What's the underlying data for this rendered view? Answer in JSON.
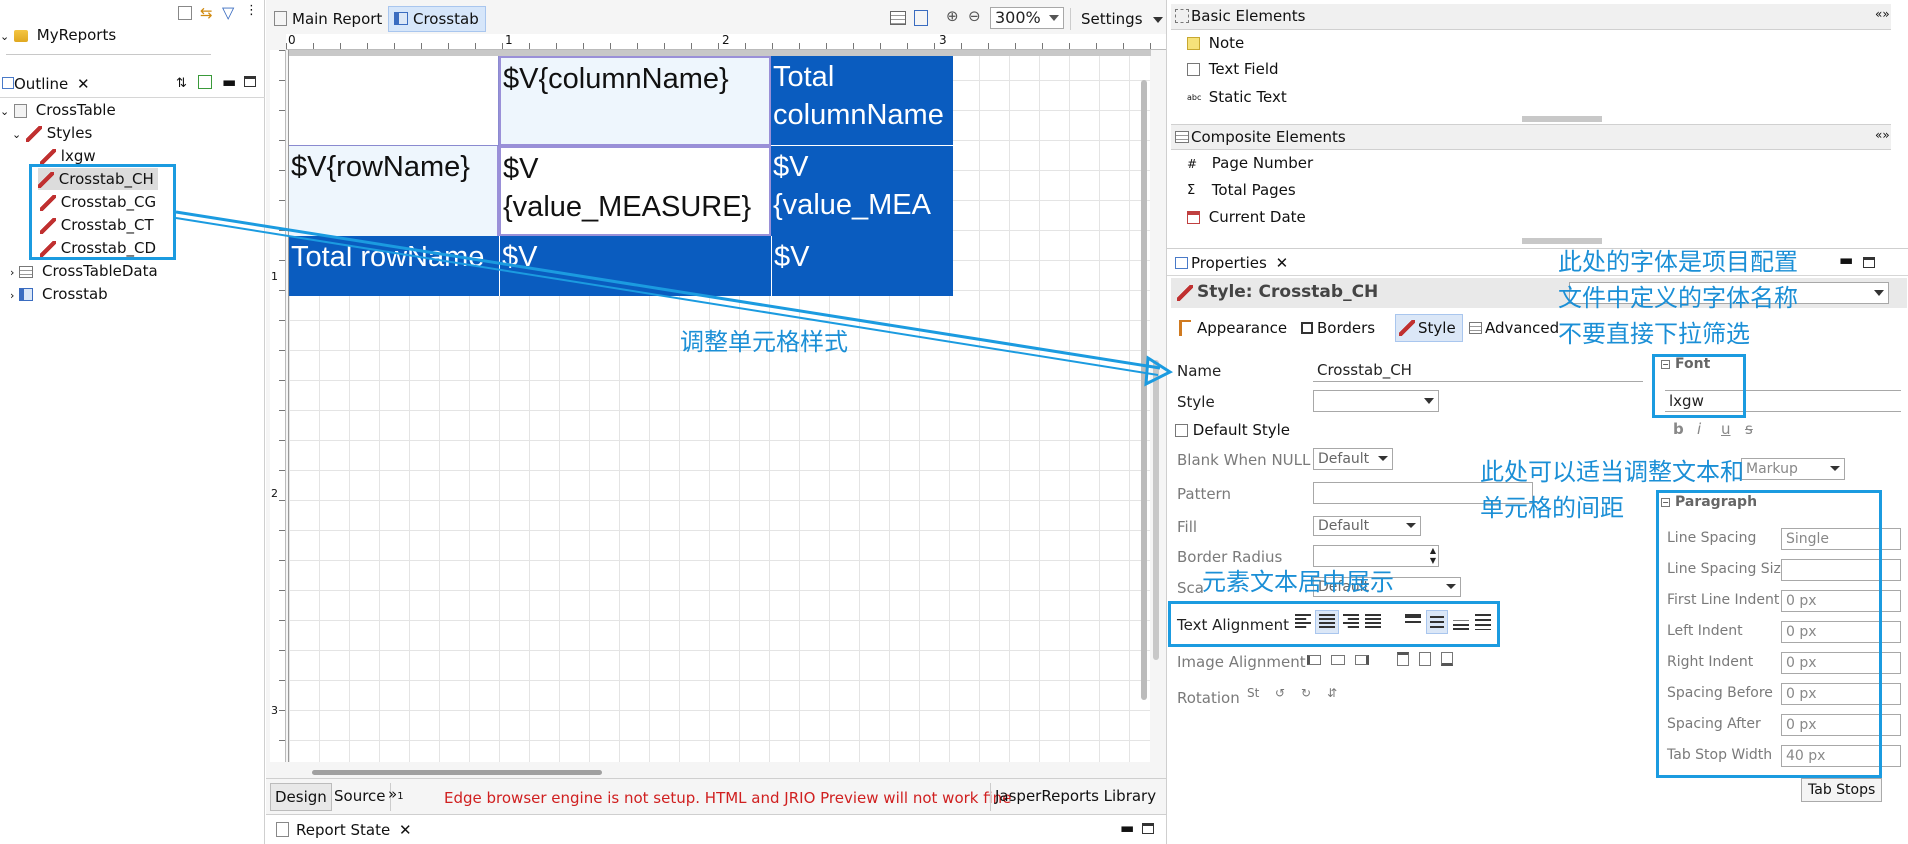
{
  "left": {
    "project_item": "MyReports",
    "outline_tab": "Outline",
    "tree": {
      "root": "CrossTable",
      "styles": "Styles",
      "style_items": [
        "lxgw",
        "Crosstab_CH",
        "Crosstab_CG",
        "Crosstab_CT",
        "Crosstab_CD"
      ],
      "data": "CrossTableData",
      "crosstab": "Crosstab"
    }
  },
  "editor": {
    "tabs": [
      "Main Report",
      "Crosstab"
    ],
    "zoom": "300%",
    "settings": "Settings",
    "ruler_marks": [
      "0",
      "1",
      "2",
      "3"
    ],
    "vruler_marks": [
      "1",
      "2",
      "3"
    ],
    "cells": {
      "r0c1": "$V{columnName}",
      "r0c2": "Total columnName",
      "r1c0": "$V{rowName}",
      "r1c1": "$V {value_MEASURE}",
      "r1c2": "$V {value_MEA",
      "r2c0": "Total rowName",
      "r2c1": "$V",
      "r2c2": "$V"
    },
    "bottom_tabs": [
      "Design",
      "Source"
    ],
    "overflow_tab": "»",
    "overflow_count": "1",
    "warning": "Edge browser engine is not setup. HTML and JRIO Preview will not work fine",
    "library_tab": "JasperReports Library",
    "report_state_tab": "Report State"
  },
  "palette": {
    "basic_title": "Basic Elements",
    "basic_items": [
      "Note",
      "Text Field",
      "Static Text"
    ],
    "composite_title": "Composite Elements",
    "composite_items": [
      "Page Number",
      "Total Pages",
      "Current Date"
    ]
  },
  "properties": {
    "tab": "Properties",
    "header": "Style: Crosstab_CH",
    "subtabs": [
      "Appearance",
      "Borders",
      "Style",
      "Advanced"
    ],
    "name_label": "Name",
    "name_value": "Crosstab_CH",
    "style_label": "Style",
    "default_style": "Default Style",
    "blank_label": "Blank When NULL",
    "blank_value": "Default",
    "pattern_label": "Pattern",
    "fill_label": "Fill",
    "fill_value": "Default",
    "radius_label": "Border Radius",
    "scale_label": "Sca",
    "scale_value": "Default",
    "text_align_label": "Text Alignment",
    "image_align_label": "Image Alignment",
    "rotation_label": "Rotation",
    "font_section": "Font",
    "font_value": "lxgw",
    "font_fmt": [
      "b",
      "i",
      "u",
      "s"
    ],
    "markup_value": "Markup",
    "paragraph_section": "Paragraph",
    "para_rows": [
      {
        "label": "Line Spacing",
        "value": "Single"
      },
      {
        "label": "Line Spacing Size",
        "value": ""
      },
      {
        "label": "First Line Indent",
        "value": "0 px"
      },
      {
        "label": "Left Indent",
        "value": "0 px"
      },
      {
        "label": "Right Indent",
        "value": "0 px"
      },
      {
        "label": "Spacing Before",
        "value": "0 px"
      },
      {
        "label": "Spacing After",
        "value": "0 px"
      },
      {
        "label": "Tab Stop Width",
        "value": "40 px"
      }
    ],
    "tab_stops": "Tab Stops"
  },
  "annotations": {
    "adjust_cell_style": "调整单元格样式",
    "font_note_1": "此处的字体是项目配置",
    "font_note_2": "文件中定义的字体名称",
    "font_note_3": "不要直接下拉筛选",
    "spacing_note_1": "此处可以适当调整文本和",
    "spacing_note_2": "单元格的间距",
    "center_note": "元素文本居中展示"
  },
  "colors": {
    "annotation": "#1b9be0",
    "cell_dark": "#0a5cbf",
    "cell_light": "#eef6fd",
    "warning": "#d02020"
  }
}
